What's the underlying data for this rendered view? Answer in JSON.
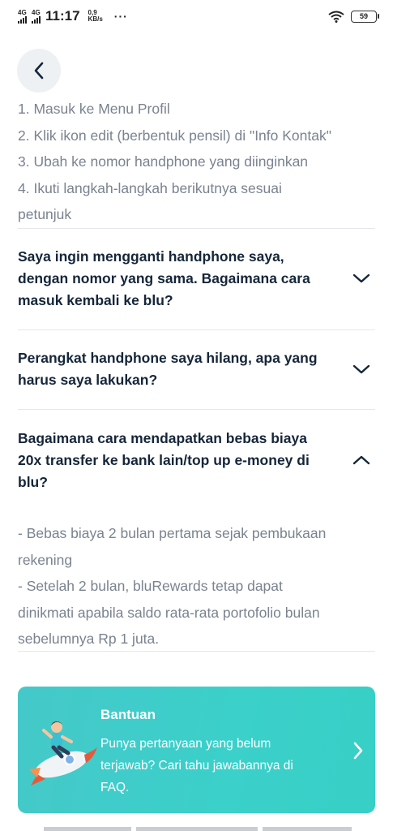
{
  "status_bar": {
    "network_1": "4G",
    "network_2": "4G",
    "time": "11:17",
    "speed_value": "0,9",
    "speed_unit": "KB/s",
    "more": "···",
    "battery": "59"
  },
  "steps": [
    "1. Masuk ke Menu Profil",
    "2. Klik ikon edit (berbentuk pensil) di \"Info Kontak\"",
    "3. Ubah ke nomor handphone yang diinginkan",
    "4. Ikuti langkah-langkah berikutnya sesuai",
    "petunjuk"
  ],
  "faq": [
    {
      "question_lines": [
        "Saya ingin mengganti handphone saya,",
        "dengan nomor yang sama. Bagaimana cara",
        "masuk kembali ke blu?"
      ],
      "expanded": false
    },
    {
      "question_lines": [
        "Perangkat handphone saya hilang, apa yang",
        "harus saya lakukan?"
      ],
      "expanded": false
    },
    {
      "question_lines": [
        "Bagaimana cara mendapatkan bebas biaya",
        "20x transfer ke bank lain/top up e-money di",
        "blu?"
      ],
      "expanded": true,
      "answer_lines": [
        "- Bebas biaya 2 bulan pertama sejak pembukaan",
        "rekening",
        "- Setelah 2 bulan, bluRewards tetap dapat",
        "dinikmati apabila saldo rata-rata portofolio bulan",
        "sebelumnya Rp 1 juta."
      ]
    }
  ],
  "help_card": {
    "title": "Bantuan",
    "text_lines": [
      "Punya pertanyaan yang belum",
      "terjawab? Cari tahu jawabannya di",
      "FAQ."
    ]
  },
  "colors": {
    "accent": "#3ccfc8",
    "heading": "#15263a",
    "body": "#7a838f"
  },
  "icons": {
    "back": "chevron-left-icon",
    "collapsed": "chevron-down-icon",
    "expanded": "chevron-up-icon",
    "card_arrow": "chevron-right-icon"
  }
}
